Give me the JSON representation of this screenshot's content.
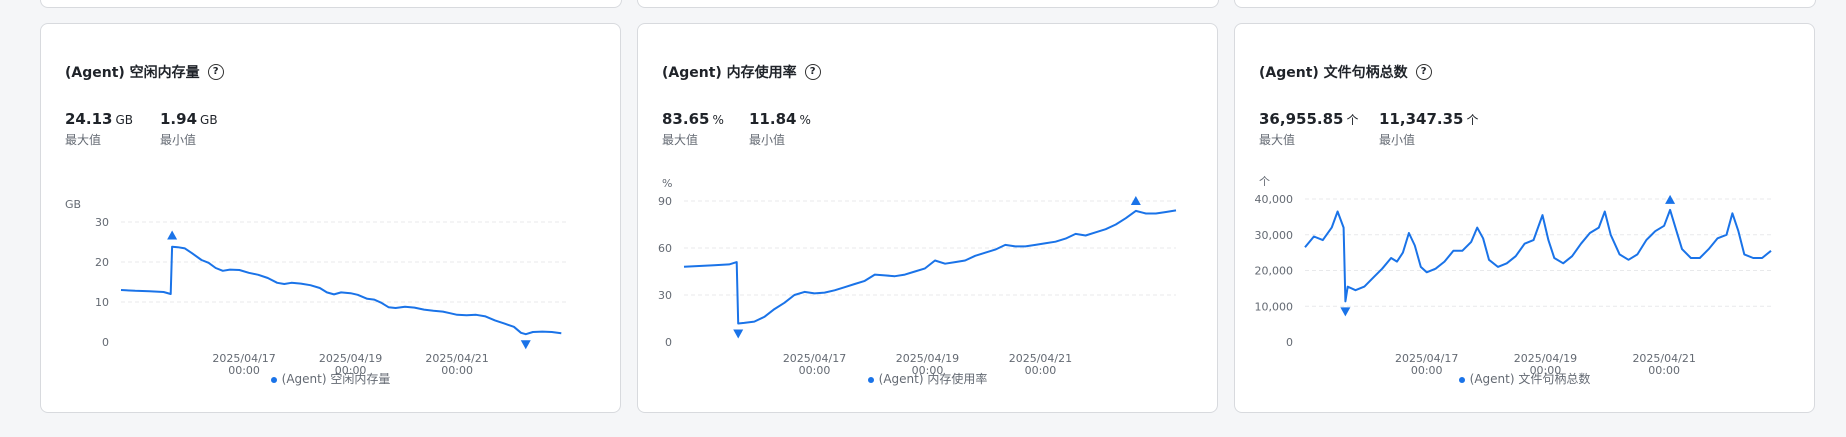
{
  "cards": [
    {
      "title": "(Agent) 空闲内存量",
      "help_icon": "question-circle-icon",
      "stats": [
        {
          "value": "24.13",
          "unit": "GB",
          "label": "最大值"
        },
        {
          "value": "1.94",
          "unit": "GB",
          "label": "最小值"
        }
      ]
    },
    {
      "title": "(Agent) 内存使用率",
      "help_icon": "question-circle-icon",
      "stats": [
        {
          "value": "83.65",
          "unit": "%",
          "label": "最大值"
        },
        {
          "value": "11.84",
          "unit": "%",
          "label": "最小值"
        }
      ]
    },
    {
      "title": "(Agent) 文件句柄总数",
      "help_icon": "question-circle-icon",
      "stats": [
        {
          "value": "36,955.85",
          "unit": "个",
          "label": "最大值"
        },
        {
          "value": "11,347.35",
          "unit": "个",
          "label": "最小值"
        }
      ]
    }
  ],
  "colors": {
    "line": "#1a73e8",
    "grid": "#e8e9eb",
    "axis_text": "#646a73"
  },
  "chart_data": [
    {
      "type": "line",
      "unit_label": "GB",
      "ylim": [
        0,
        30
      ],
      "yticks": [
        "0",
        "10",
        "20",
        "30"
      ],
      "ytick_values": [
        0,
        10,
        20,
        30
      ],
      "xticks": [
        {
          "date": "2025/04/17",
          "time": "00:00",
          "x": 2
        },
        {
          "date": "2025/04/19",
          "time": "00:00",
          "x": 4
        },
        {
          "date": "2025/04/21",
          "time": "00:00",
          "x": 6
        }
      ],
      "xlim": [
        0,
        7.3
      ],
      "series": [
        {
          "name": "(Agent) 空闲内存量",
          "points": [
            [
              0,
              13
            ],
            [
              0.3,
              12.8
            ],
            [
              0.6,
              12.7
            ],
            [
              0.9,
              12.5
            ],
            [
              1.05,
              12
            ],
            [
              1.08,
              23.8
            ],
            [
              1.2,
              23.7
            ],
            [
              1.35,
              23.4
            ],
            [
              1.5,
              22.2
            ],
            [
              1.7,
              20.5
            ],
            [
              1.85,
              19.8
            ],
            [
              2,
              18.5
            ],
            [
              2.15,
              17.8
            ],
            [
              2.3,
              18.1
            ],
            [
              2.5,
              18
            ],
            [
              2.7,
              17.3
            ],
            [
              2.9,
              16.8
            ],
            [
              3.1,
              16
            ],
            [
              3.3,
              14.8
            ],
            [
              3.45,
              14.5
            ],
            [
              3.6,
              14.8
            ],
            [
              3.8,
              14.6
            ],
            [
              4,
              14.2
            ],
            [
              4.2,
              13.5
            ],
            [
              4.35,
              12.4
            ],
            [
              4.5,
              11.9
            ],
            [
              4.65,
              12.4
            ],
            [
              4.85,
              12.2
            ],
            [
              5,
              11.8
            ],
            [
              5.2,
              10.8
            ],
            [
              5.35,
              10.6
            ],
            [
              5.5,
              9.8
            ],
            [
              5.65,
              8.7
            ],
            [
              5.8,
              8.5
            ],
            [
              6,
              8.8
            ],
            [
              6.2,
              8.6
            ],
            [
              6.4,
              8.1
            ],
            [
              6.6,
              7.8
            ],
            [
              6.8,
              7.6
            ],
            [
              6.95,
              7.2
            ],
            [
              7.1,
              6.8
            ],
            [
              7.3,
              6.7
            ],
            [
              7.5,
              6.8
            ],
            [
              7.7,
              6.4
            ],
            [
              7.9,
              5.4
            ],
            [
              8.1,
              4.6
            ],
            [
              8.3,
              3.8
            ],
            [
              8.45,
              2.3
            ],
            [
              8.55,
              1.94
            ],
            [
              8.7,
              2.5
            ],
            [
              8.9,
              2.6
            ],
            [
              9.1,
              2.5
            ],
            [
              9.3,
              2.2
            ]
          ],
          "max": {
            "value": 24.13,
            "at": 1.08
          },
          "min": {
            "value": 1.94,
            "at": 8.55
          }
        }
      ]
    },
    {
      "type": "line",
      "unit_label": "%",
      "ylim": [
        0,
        90
      ],
      "yticks": [
        "0",
        "30",
        "60",
        "90"
      ],
      "ytick_values": [
        0,
        30,
        60,
        90
      ],
      "xticks": [
        {
          "date": "2025/04/17",
          "time": "00:00",
          "x": 2
        },
        {
          "date": "2025/04/19",
          "time": "00:00",
          "x": 4
        },
        {
          "date": "2025/04/21",
          "time": "00:00",
          "x": 6
        }
      ],
      "xlim": [
        0,
        7.3
      ],
      "series": [
        {
          "name": "(Agent) 内存使用率",
          "points": [
            [
              0,
              48
            ],
            [
              0.3,
              48.5
            ],
            [
              0.6,
              49
            ],
            [
              0.9,
              49.5
            ],
            [
              1.05,
              51
            ],
            [
              1.08,
              11.84
            ],
            [
              1.2,
              12.2
            ],
            [
              1.4,
              13
            ],
            [
              1.6,
              16
            ],
            [
              1.8,
              21
            ],
            [
              2,
              25
            ],
            [
              2.2,
              30
            ],
            [
              2.4,
              32
            ],
            [
              2.6,
              31
            ],
            [
              2.8,
              31.5
            ],
            [
              3,
              33
            ],
            [
              3.2,
              35
            ],
            [
              3.4,
              37
            ],
            [
              3.6,
              39
            ],
            [
              3.8,
              43
            ],
            [
              4,
              42.5
            ],
            [
              4.2,
              42
            ],
            [
              4.4,
              43
            ],
            [
              4.6,
              45
            ],
            [
              4.8,
              47
            ],
            [
              5,
              52
            ],
            [
              5.2,
              50
            ],
            [
              5.4,
              51
            ],
            [
              5.6,
              52
            ],
            [
              5.8,
              55
            ],
            [
              6,
              57
            ],
            [
              6.2,
              59
            ],
            [
              6.4,
              62
            ],
            [
              6.6,
              61
            ],
            [
              6.8,
              61
            ],
            [
              7,
              62
            ],
            [
              7.2,
              63
            ],
            [
              7.4,
              64
            ],
            [
              7.6,
              66
            ],
            [
              7.8,
              69
            ],
            [
              8,
              68
            ],
            [
              8.2,
              70
            ],
            [
              8.4,
              72
            ],
            [
              8.6,
              75
            ],
            [
              8.8,
              79
            ],
            [
              9,
              83.65
            ],
            [
              9.2,
              82
            ],
            [
              9.4,
              82
            ],
            [
              9.6,
              83
            ],
            [
              9.8,
              84
            ]
          ],
          "max": {
            "value": 83.65,
            "at": 9.0
          },
          "min": {
            "value": 11.84,
            "at": 1.08
          }
        }
      ]
    },
    {
      "type": "line",
      "unit_label": "个",
      "ylim": [
        0,
        40000
      ],
      "yticks": [
        "0",
        "10,000",
        "20,000",
        "30,000",
        "40,000"
      ],
      "ytick_values": [
        0,
        10000,
        20000,
        30000,
        40000
      ],
      "xticks": [
        {
          "date": "2025/04/17",
          "time": "00:00",
          "x": 2
        },
        {
          "date": "2025/04/19",
          "time": "00:00",
          "x": 4
        },
        {
          "date": "2025/04/21",
          "time": "00:00",
          "x": 6
        }
      ],
      "xlim": [
        0,
        7.3
      ],
      "series": [
        {
          "name": "(Agent) 文件句柄总数",
          "points": [
            [
              0,
              26500
            ],
            [
              0.15,
              29500
            ],
            [
              0.3,
              28500
            ],
            [
              0.45,
              32000
            ],
            [
              0.55,
              36500
            ],
            [
              0.65,
              32000
            ],
            [
              0.68,
              11347
            ],
            [
              0.72,
              15500
            ],
            [
              0.85,
              14500
            ],
            [
              1,
              15500
            ],
            [
              1.15,
              18000
            ],
            [
              1.3,
              20500
            ],
            [
              1.45,
              23500
            ],
            [
              1.55,
              22500
            ],
            [
              1.65,
              25000
            ],
            [
              1.75,
              30500
            ],
            [
              1.85,
              27000
            ],
            [
              1.95,
              21000
            ],
            [
              2.05,
              19500
            ],
            [
              2.2,
              20500
            ],
            [
              2.35,
              22500
            ],
            [
              2.5,
              25500
            ],
            [
              2.65,
              25500
            ],
            [
              2.8,
              28000
            ],
            [
              2.9,
              32000
            ],
            [
              3,
              29000
            ],
            [
              3.1,
              23000
            ],
            [
              3.25,
              21000
            ],
            [
              3.4,
              22000
            ],
            [
              3.55,
              24000
            ],
            [
              3.7,
              27500
            ],
            [
              3.85,
              28500
            ],
            [
              4,
              35500
            ],
            [
              4.1,
              28500
            ],
            [
              4.2,
              23500
            ],
            [
              4.35,
              22000
            ],
            [
              4.5,
              24000
            ],
            [
              4.65,
              27500
            ],
            [
              4.8,
              30500
            ],
            [
              4.95,
              32000
            ],
            [
              5.05,
              36500
            ],
            [
              5.15,
              30000
            ],
            [
              5.3,
              24500
            ],
            [
              5.45,
              23000
            ],
            [
              5.6,
              24500
            ],
            [
              5.75,
              28500
            ],
            [
              5.9,
              31000
            ],
            [
              6.05,
              32500
            ],
            [
              6.15,
              36955
            ],
            [
              6.25,
              31500
            ],
            [
              6.35,
              26000
            ],
            [
              6.5,
              23500
            ],
            [
              6.65,
              23500
            ],
            [
              6.8,
              26000
            ],
            [
              6.95,
              29000
            ],
            [
              7.1,
              30000
            ],
            [
              7.2,
              36000
            ],
            [
              7.3,
              31000
            ],
            [
              7.4,
              24500
            ],
            [
              7.55,
              23500
            ],
            [
              7.7,
              23500
            ],
            [
              7.85,
              25500
            ]
          ],
          "max": {
            "value": 36955.85,
            "at": 6.15
          },
          "min": {
            "value": 11347.35,
            "at": 0.68
          }
        }
      ]
    }
  ]
}
